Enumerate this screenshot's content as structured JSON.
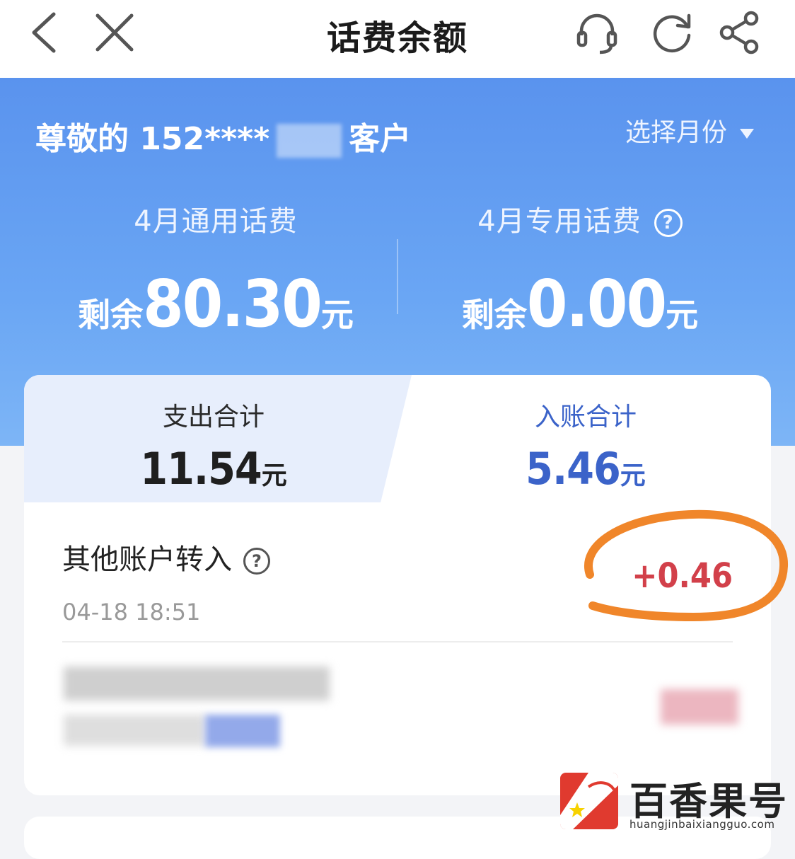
{
  "nav": {
    "title": "话费余额",
    "back_icon": "chevron-left-icon",
    "close_icon": "close-icon",
    "service_icon": "headset-icon",
    "refresh_icon": "refresh-icon",
    "share_icon": "share-icon"
  },
  "header": {
    "greeting_prefix": "尊敬的 152****",
    "greeting_suffix": "客户",
    "month_selector": "选择月份"
  },
  "balances": [
    {
      "label": "4月通用话费",
      "prefix": "剩余",
      "amount": "80.30",
      "unit": "元"
    },
    {
      "label": "4月专用话费",
      "prefix": "剩余",
      "amount": "0.00",
      "unit": "元",
      "help": "?"
    }
  ],
  "summary": {
    "expense_label": "支出合计",
    "expense_amount": "11.54",
    "income_label": "入账合计",
    "income_amount": "5.46",
    "unit": "元"
  },
  "records": [
    {
      "title": "其他账户转入",
      "help": "?",
      "time": "04-18 18:51",
      "amount": "+0.46"
    }
  ],
  "watermark": {
    "name": "百香果号",
    "url": "huangjinbaixiangguo.com"
  },
  "colors": {
    "accent": "#5a93ee",
    "income": "#3b63c9",
    "amount_positive": "#d2404a",
    "annotation": "#f0862a"
  }
}
